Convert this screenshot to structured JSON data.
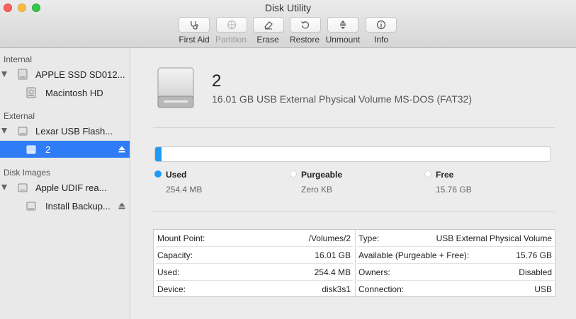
{
  "window": {
    "title": "Disk Utility"
  },
  "toolbar": {
    "buttons": [
      {
        "label": "First Aid",
        "icon": "stethoscope-icon",
        "enabled": true
      },
      {
        "label": "Partition",
        "icon": "pie-icon",
        "enabled": false
      },
      {
        "label": "Erase",
        "icon": "erase-icon",
        "enabled": true
      },
      {
        "label": "Restore",
        "icon": "restore-icon",
        "enabled": true
      },
      {
        "label": "Unmount",
        "icon": "unmount-icon",
        "enabled": true
      },
      {
        "label": "Info",
        "icon": "info-icon",
        "enabled": true
      }
    ]
  },
  "sidebar": {
    "sections": [
      {
        "header": "Internal"
      },
      {
        "header": "External"
      },
      {
        "header": "Disk Images"
      }
    ],
    "items": [
      {
        "label": "APPLE SSD SD012...",
        "icon": "hard-disk-icon",
        "level": 0,
        "expanded": true
      },
      {
        "label": "Macintosh HD",
        "icon": "hard-disk-icon",
        "level": 1
      },
      {
        "label": "Lexar USB Flash...",
        "icon": "external-disk-icon",
        "level": 0,
        "expanded": true
      },
      {
        "label": "2",
        "icon": "external-disk-icon",
        "level": 1,
        "selected": true,
        "ejectable": true
      },
      {
        "label": "Apple UDIF rea...",
        "icon": "external-disk-icon",
        "level": 0,
        "expanded": true
      },
      {
        "label": "Install Backup...",
        "icon": "external-disk-icon",
        "level": 1,
        "ejectable": true
      }
    ]
  },
  "volume": {
    "name": "2",
    "description": "16.01 GB USB External Physical Volume MS-DOS (FAT32)"
  },
  "usage": {
    "used_fraction": 0.016,
    "legend": [
      {
        "name": "Used",
        "value": "254.4 MB",
        "color": "#1d9bf6"
      },
      {
        "name": "Purgeable",
        "value": "Zero KB",
        "color": "#ffffff"
      },
      {
        "name": "Free",
        "value": "15.76 GB",
        "color": "#ffffff"
      }
    ]
  },
  "info": {
    "left": [
      {
        "key": "Mount Point:",
        "value": "/Volumes/2"
      },
      {
        "key": "Capacity:",
        "value": "16.01 GB"
      },
      {
        "key": "Used:",
        "value": "254.4 MB"
      },
      {
        "key": "Device:",
        "value": "disk3s1"
      }
    ],
    "right": [
      {
        "key": "Type:",
        "value": "USB External Physical Volume"
      },
      {
        "key": "Available (Purgeable + Free):",
        "value": "15.76 GB"
      },
      {
        "key": "Owners:",
        "value": "Disabled"
      },
      {
        "key": "Connection:",
        "value": "USB"
      }
    ]
  },
  "colors": {
    "accent": "#2f7cf6",
    "used": "#1d9bf6"
  }
}
